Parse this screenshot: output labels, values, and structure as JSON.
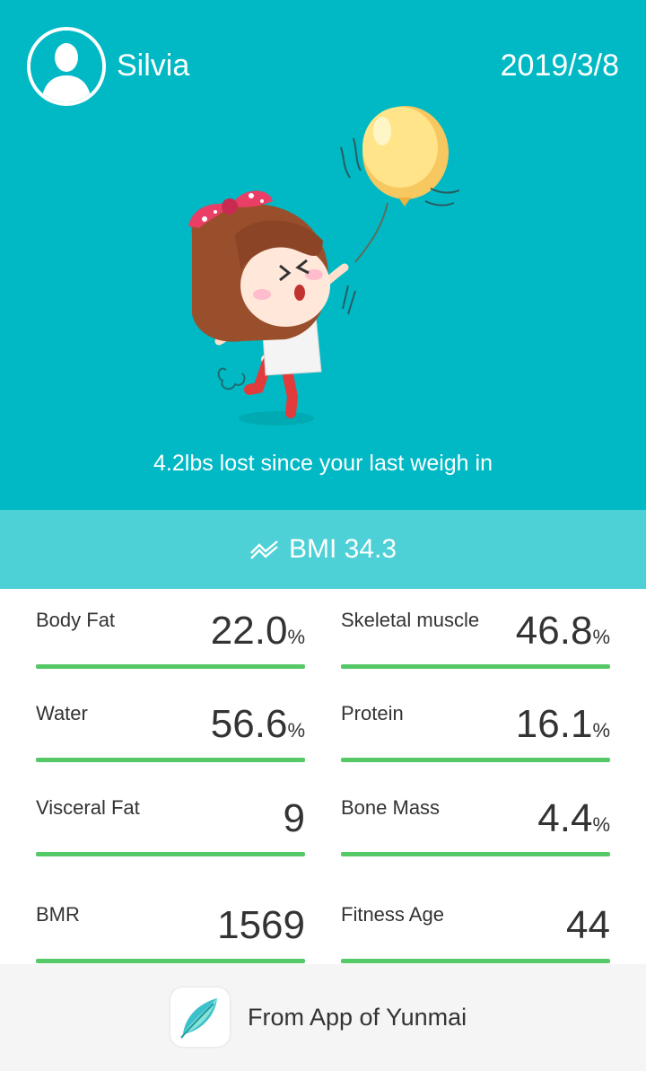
{
  "header": {
    "username": "Silvia",
    "date": "2019/3/8"
  },
  "hero": {
    "message": "4.2lbs lost since your last weigh in"
  },
  "bmi": {
    "label": "BMI 34.3"
  },
  "metrics": [
    {
      "label": "Body Fat",
      "value": "22.0",
      "unit": "%"
    },
    {
      "label": "Skeletal muscle",
      "value": "46.8",
      "unit": "%"
    },
    {
      "label": "Water",
      "value": "56.6",
      "unit": "%"
    },
    {
      "label": "Protein",
      "value": "16.1",
      "unit": "%"
    },
    {
      "label": "Visceral Fat",
      "value": "9",
      "unit": ""
    },
    {
      "label": "Bone Mass",
      "value": "4.4",
      "unit": "%"
    },
    {
      "label": "BMR",
      "value": "1569",
      "unit": ""
    },
    {
      "label": "Fitness Age",
      "value": "44",
      "unit": ""
    }
  ],
  "footer": {
    "text": "From App of Yunmai"
  },
  "colors": {
    "hero_bg": "#00b9c4",
    "bmi_bg": "#4dd0d6",
    "progress_bar": "#55c966",
    "footer_bg": "#f5f5f5"
  },
  "icons": {
    "avatar": "user-silhouette-icon",
    "bmi": "trend-chart-icon",
    "app": "yunmai-leaf-icon"
  }
}
